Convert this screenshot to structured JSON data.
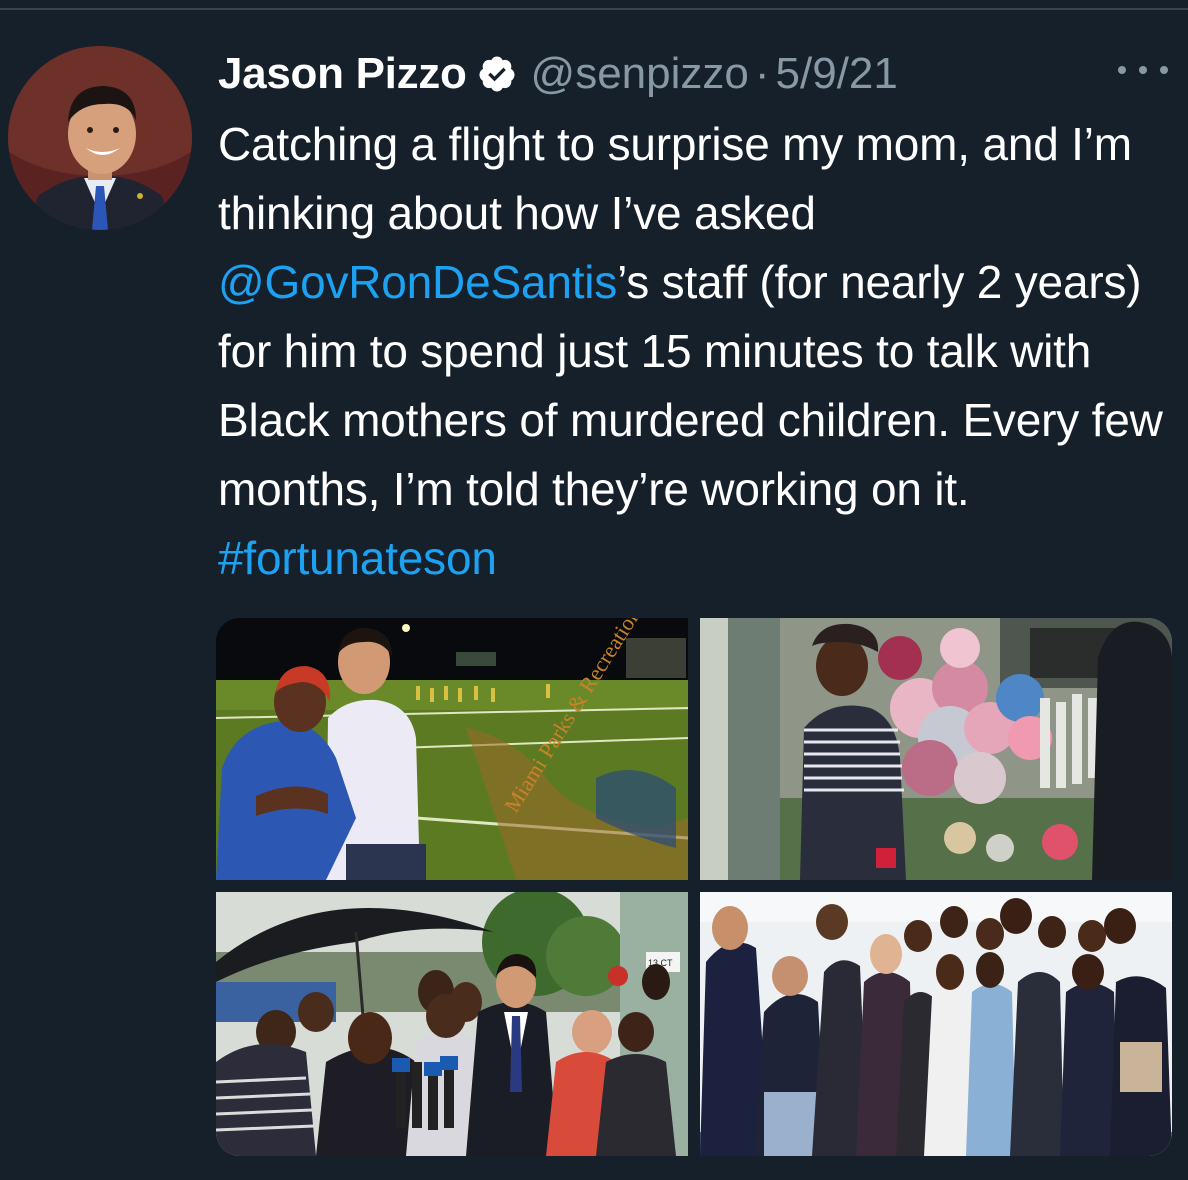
{
  "tweet": {
    "display_name": "Jason Pizzo",
    "verified_icon": "verified-badge-icon",
    "handle": "@senpizzo",
    "separator": "·",
    "date": "5/9/21",
    "more_icon": "more-options-icon",
    "text": {
      "part1": "Catching a flight to surprise my mom, and I’m thinking about how I’ve asked ",
      "mention": "@GovRonDeSantis",
      "part2": "’s staff (for nearly 2 years) for him to spend just 15 minutes to talk with Black mothers of murdered children. Every few months, I’m  told they’re working on it. ",
      "hashtag": "#fortunateson"
    },
    "media": {
      "photo_1_sign": "Miami Parks & Recreation",
      "photo_3_sign": "13 CT"
    }
  },
  "colors": {
    "background": "#15202b",
    "text_primary": "#ffffff",
    "text_secondary": "#8899a6",
    "link": "#1da1f2",
    "verified_badge": "#ffffff"
  }
}
